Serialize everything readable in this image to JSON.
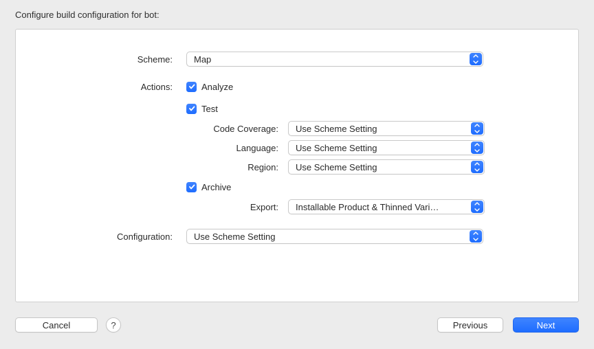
{
  "title": "Configure build configuration for bot:",
  "labels": {
    "scheme": "Scheme:",
    "actions": "Actions:",
    "codeCoverage": "Code Coverage:",
    "language": "Language:",
    "region": "Region:",
    "export": "Export:",
    "configuration": "Configuration:"
  },
  "checkboxes": {
    "analyze": "Analyze",
    "test": "Test",
    "archive": "Archive"
  },
  "values": {
    "scheme": "Map",
    "codeCoverage": "Use Scheme Setting",
    "language": "Use Scheme Setting",
    "region": "Use Scheme Setting",
    "export": "Installable Product & Thinned Vari…",
    "configuration": "Use Scheme Setting"
  },
  "buttons": {
    "cancel": "Cancel",
    "help": "?",
    "previous": "Previous",
    "next": "Next"
  }
}
